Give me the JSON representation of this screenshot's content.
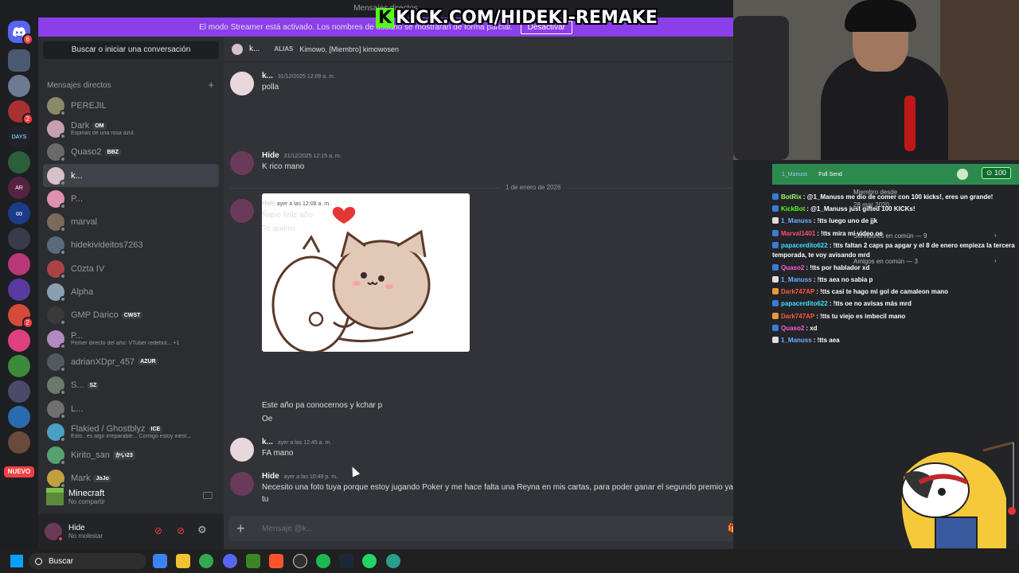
{
  "top": {
    "title": "Mensajes directos"
  },
  "kick": {
    "letter": "K",
    "text": "KICK.COM/HIDEKI-REMAKE"
  },
  "streamer": {
    "notice": "El modo Streamer está activado. Los nombres de usuario se mostrarán de forma parcial.",
    "deactivate": "Desactivar"
  },
  "guilds": {
    "badges": {
      "home": "6",
      "g3": "2",
      "g9": "2"
    },
    "new_label": "NUEVO"
  },
  "sidebar": {
    "search": "Buscar o iniciar una conversación",
    "dm_header": "Mensajes directos",
    "add": "+",
    "items": [
      {
        "name": "PEREJIL",
        "sub": "",
        "tag": ""
      },
      {
        "name": "Dark",
        "sub": "Espinas de una rosa azul.",
        "tag": "OM"
      },
      {
        "name": "Quaso2",
        "sub": "",
        "tag": "BBZ"
      },
      {
        "name": "k...",
        "sub": "",
        "tag": ""
      },
      {
        "name": "P...",
        "sub": "",
        "tag": ""
      },
      {
        "name": "marval",
        "sub": "",
        "tag": ""
      },
      {
        "name": "hidekivideitos7263",
        "sub": "",
        "tag": ""
      },
      {
        "name": "C0zta IV",
        "sub": "",
        "tag": ""
      },
      {
        "name": "Alpha",
        "sub": "",
        "tag": ""
      },
      {
        "name": "GMP Darico",
        "sub": "",
        "tag": "CWST"
      },
      {
        "name": "P...",
        "sub": "Primer directo del año: VTuber redebut... +1",
        "tag": ""
      },
      {
        "name": "adrianXDpr_457",
        "sub": "",
        "tag": "AZUR"
      },
      {
        "name": "S...",
        "sub": "",
        "tag": "SZ"
      },
      {
        "name": "L...",
        "sub": "",
        "tag": ""
      },
      {
        "name": "Flakied / Ghostblyz",
        "sub": "Esto.. es algo irreparable... Contigo estoy inest...",
        "tag": "ICE"
      },
      {
        "name": "Kirito_san",
        "sub": "",
        "tag": "かい23"
      },
      {
        "name": "Mark",
        "sub": "",
        "tag": "JoJo"
      }
    ],
    "activity": {
      "title": "Minecraft",
      "sub": "No compartir"
    },
    "user": {
      "name": "Hide",
      "status": "No molestar"
    }
  },
  "chat": {
    "header": {
      "name": "k...",
      "alias_label": "ALIAS",
      "alias": "Kimowo, [Miembro] kimowosen"
    },
    "messages": [
      {
        "author": "k...",
        "time": "31/12/2025 12:09 a. m.",
        "text": "polla"
      },
      {
        "author": "Hide",
        "time": "31/12/2025 12:15 a. m.",
        "text": "K rico mano"
      },
      {
        "author": "Hide",
        "time": "ayer a las 12:08 a. m.",
        "text": "Ñano feliz año"
      },
      {
        "author": "",
        "time": "",
        "text": "Te quiero"
      },
      {
        "author": "",
        "time": "",
        "text": "Este año pa conocernos y kchar p"
      },
      {
        "author": "",
        "time": "",
        "text": "Oe"
      },
      {
        "author": "k...",
        "time": "ayer a las 12:45 a. m.",
        "text": "FA mano"
      },
      {
        "author": "Hide",
        "time": "ayer a las 10:49 p. m.",
        "text": "Necesito una foto tuya porque estoy jugando Poker y me hace falta una Reyna en mis cartas, para poder ganar el segundo premio ya que el primero, serás"
      },
      {
        "author": "",
        "time": "",
        "text": "tu"
      }
    ],
    "date_divider": "1 de enero de 2026",
    "composer_placeholder": "Mensaje @k..."
  },
  "profile": {
    "member_since_label": "Miembro desde",
    "member_since": "28 mar 2020",
    "servers_common": "Servidores en común — 9",
    "friends_common": "Amigos en común — 3"
  },
  "stream_chat": {
    "bar_user": "1_Manuss",
    "bar_label": "Full Send",
    "count": "100",
    "lines": [
      {
        "user": "BotRix",
        "text": ": @1_Manuss me dio de comer con 100 kicks!, eres un grande!",
        "color": "#9cff5e"
      },
      {
        "user": "KickBot",
        "text": ": @1_Manuss just gifted 100 KICKs!",
        "color": "#53fc18"
      },
      {
        "user": "1_Manuss",
        "text": ": !tts luego uno de jjk",
        "color": "#6bb3ff"
      },
      {
        "user": "Marval1401",
        "text": ": !tts mira mi video oe",
        "color": "#ff4d6d"
      },
      {
        "user": "papacerdito622",
        "text": ": !tts faltan 2 caps pa apgar y el 8 de enero empieza la tercera temporada, te voy avisando mrd",
        "color": "#3de0ff"
      },
      {
        "user": "Quaso2",
        "text": ": !tts por hablador xd",
        "color": "#ff5fd2"
      },
      {
        "user": "1_Manuss",
        "text": ": !tts aea no sabia p",
        "color": "#6bb3ff"
      },
      {
        "user": "Dark747AP",
        "text": ": !tts casi te hago mi gol de camaleon mano",
        "color": "#ff5a3c"
      },
      {
        "user": "papacerdito622",
        "text": ": !tts oe no avisas más mrd",
        "color": "#3de0ff"
      },
      {
        "user": "Dark747AP",
        "text": ": !tts tu viejo es imbecil mano",
        "color": "#ff5a3c"
      },
      {
        "user": "Quaso2",
        "text": ": xd",
        "color": "#ff5fd2"
      },
      {
        "user": "1_Manuss",
        "text": ": !tts aea",
        "color": "#6bb3ff"
      }
    ]
  },
  "taskbar": {
    "search": "Buscar"
  }
}
